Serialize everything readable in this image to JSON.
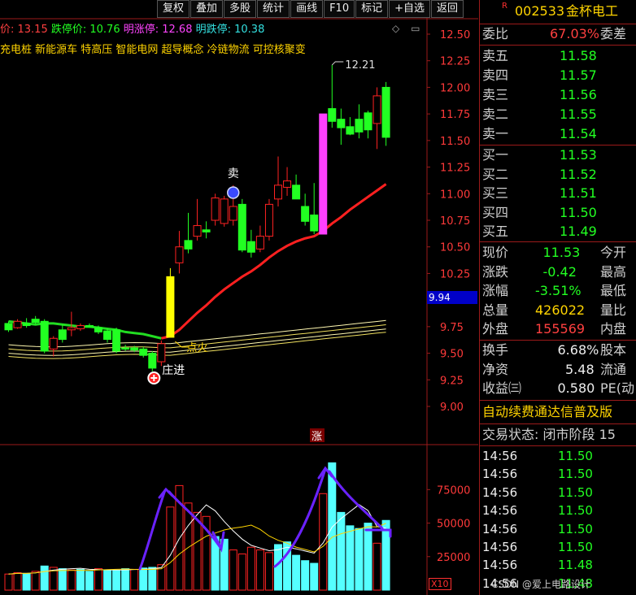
{
  "toolbar": [
    "复权",
    "叠加",
    "多股",
    "统计",
    "画线",
    "F10",
    "标记",
    "+自选",
    "返回"
  ],
  "info_line": [
    {
      "text": "价: 13.15",
      "color": "#ff4040"
    },
    {
      "text": "跌停价: 10.76",
      "color": "#22ff22"
    },
    {
      "text": "明涨停: 12.68",
      "color": "#ff44ff"
    },
    {
      "text": "明跌停: 10.38",
      "color": "#33e0e0"
    }
  ],
  "concepts": "充电桩 新能源车 特高压 智能电网 超导概念 冷链物流 可控核聚变",
  "win_icons": [
    "◇",
    "▭"
  ],
  "price_tag": "9.94",
  "volume_unit": "X10",
  "annotations": {
    "sell": "卖",
    "zhang": "涨",
    "dianguang": "点火",
    "zhuangjin": "庄进",
    "max_label": "12.21"
  },
  "colors": {
    "up": "#ff2222",
    "down": "#22ff22",
    "limit_up": "#ff40ff",
    "yellow_bar": "#ffff00",
    "ma": "#ff2020",
    "ma_green": "#22dd22",
    "cyan_vol": "#55ffff"
  },
  "chart_data": {
    "type": "candlestick",
    "price_axis": {
      "ticks": [
        "12.50",
        "12.25",
        "12.00",
        "11.75",
        "11.50",
        "11.25",
        "11.00",
        "10.75",
        "10.50",
        "10.25",
        "10.00",
        "9.75",
        "9.50",
        "9.25",
        "9.00"
      ],
      "range": [
        9.0,
        12.5
      ]
    },
    "volume_axis": {
      "ticks": [
        "75000",
        "50000",
        "25000"
      ]
    },
    "candles": [
      {
        "o": 9.78,
        "h": 9.8,
        "l": 9.7,
        "c": 9.72
      },
      {
        "o": 9.74,
        "h": 9.82,
        "l": 9.73,
        "c": 9.8
      },
      {
        "o": 9.78,
        "h": 9.83,
        "l": 9.74,
        "c": 9.76
      },
      {
        "o": 9.82,
        "h": 9.85,
        "l": 9.77,
        "c": 9.79
      },
      {
        "o": 9.8,
        "h": 9.82,
        "l": 9.5,
        "c": 9.52
      },
      {
        "o": 9.54,
        "h": 9.66,
        "l": 9.47,
        "c": 9.64
      },
      {
        "o": 9.72,
        "h": 9.77,
        "l": 9.6,
        "c": 9.63
      },
      {
        "o": 9.72,
        "h": 9.89,
        "l": 9.66,
        "c": 9.74
      },
      {
        "o": 9.73,
        "h": 9.78,
        "l": 9.71,
        "c": 9.76
      },
      {
        "o": 9.76,
        "h": 9.78,
        "l": 9.74,
        "c": 9.75
      },
      {
        "o": 9.74,
        "h": 9.76,
        "l": 9.68,
        "c": 9.7
      },
      {
        "o": 9.71,
        "h": 9.73,
        "l": 9.6,
        "c": 9.63
      },
      {
        "o": 9.72,
        "h": 9.74,
        "l": 9.5,
        "c": 9.52
      },
      {
        "o": 9.55,
        "h": 9.58,
        "l": 9.52,
        "c": 9.54
      },
      {
        "o": 9.55,
        "h": 9.57,
        "l": 9.51,
        "c": 9.53
      },
      {
        "o": 9.54,
        "h": 9.56,
        "l": 9.46,
        "c": 9.48
      },
      {
        "o": 9.5,
        "h": 9.52,
        "l": 9.33,
        "c": 9.36
      },
      {
        "o": 9.42,
        "h": 9.62,
        "l": 9.38,
        "c": 9.59
      },
      {
        "o": 9.65,
        "h": 10.3,
        "l": 9.65,
        "c": 10.22
      },
      {
        "o": 10.35,
        "h": 10.65,
        "l": 10.25,
        "c": 10.5
      },
      {
        "o": 10.56,
        "h": 10.82,
        "l": 10.44,
        "c": 10.48
      },
      {
        "o": 10.6,
        "h": 10.95,
        "l": 10.56,
        "c": 10.7
      },
      {
        "o": 10.66,
        "h": 10.74,
        "l": 10.58,
        "c": 10.64
      },
      {
        "o": 10.75,
        "h": 11.0,
        "l": 10.7,
        "c": 10.96
      },
      {
        "o": 10.72,
        "h": 10.98,
        "l": 10.69,
        "c": 10.95
      },
      {
        "o": 10.75,
        "h": 11.08,
        "l": 10.7,
        "c": 10.88
      },
      {
        "o": 10.9,
        "h": 10.95,
        "l": 10.45,
        "c": 10.47
      },
      {
        "o": 10.55,
        "h": 10.66,
        "l": 10.4,
        "c": 10.45
      },
      {
        "o": 10.48,
        "h": 10.7,
        "l": 10.45,
        "c": 10.6
      },
      {
        "o": 10.6,
        "h": 10.95,
        "l": 10.56,
        "c": 10.9
      },
      {
        "o": 10.95,
        "h": 11.35,
        "l": 10.88,
        "c": 11.08
      },
      {
        "o": 11.06,
        "h": 11.25,
        "l": 10.98,
        "c": 11.12
      },
      {
        "o": 11.08,
        "h": 11.18,
        "l": 10.96,
        "c": 10.95
      },
      {
        "o": 10.88,
        "h": 11.0,
        "l": 10.7,
        "c": 10.74
      },
      {
        "o": 10.8,
        "h": 11.1,
        "l": 10.62,
        "c": 10.65
      },
      {
        "o": 10.62,
        "h": 11.75,
        "l": 10.62,
        "c": 11.75
      },
      {
        "o": 11.8,
        "h": 12.21,
        "l": 11.62,
        "c": 11.68
      },
      {
        "o": 11.7,
        "h": 11.8,
        "l": 11.46,
        "c": 11.62
      },
      {
        "o": 11.63,
        "h": 11.72,
        "l": 11.55,
        "c": 11.56
      },
      {
        "o": 11.7,
        "h": 11.84,
        "l": 11.52,
        "c": 11.58
      },
      {
        "o": 11.76,
        "h": 11.78,
        "l": 11.52,
        "c": 11.6
      },
      {
        "o": 11.66,
        "h": 12.0,
        "l": 11.42,
        "c": 11.92
      },
      {
        "o": 12.0,
        "h": 12.05,
        "l": 11.45,
        "c": 11.53
      }
    ],
    "ma": [
      9.8,
      9.79,
      9.78,
      9.77,
      9.78,
      9.78,
      9.77,
      9.76,
      9.75,
      9.75,
      9.74,
      9.73,
      9.72,
      9.7,
      9.69,
      9.68,
      9.66,
      9.64,
      9.66,
      9.72,
      9.8,
      9.88,
      9.95,
      10.03,
      10.1,
      10.16,
      10.22,
      10.27,
      10.33,
      10.4,
      10.46,
      10.51,
      10.55,
      10.58,
      10.6,
      10.65,
      10.72,
      10.78,
      10.85,
      10.91,
      10.97,
      11.03,
      11.09
    ],
    "volumes": [
      12000,
      13000,
      12500,
      14000,
      18000,
      17000,
      16000,
      15000,
      15500,
      14000,
      16000,
      15000,
      14500,
      16000,
      15500,
      16500,
      17000,
      19000,
      62000,
      78000,
      65000,
      58000,
      55000,
      40000,
      38000,
      30000,
      27000,
      32000,
      30000,
      28000,
      34000,
      36000,
      26000,
      22000,
      20000,
      72000,
      95000,
      58000,
      48000,
      46000,
      50000,
      35000,
      52000
    ],
    "vol_colors_up": [
      true,
      true,
      false,
      true,
      false,
      true,
      false,
      true,
      false,
      false,
      true,
      false,
      false,
      false,
      true,
      false,
      false,
      true,
      true,
      true,
      true,
      true,
      true,
      false,
      false,
      true,
      true,
      true,
      true,
      true,
      false,
      false,
      false,
      false,
      false,
      true,
      false,
      false,
      false,
      false,
      false,
      true,
      false
    ]
  },
  "stock": {
    "code": "002533",
    "name": "金杯电工",
    "flag": "R"
  },
  "order_ratio": {
    "label": "委比",
    "value": "67.03%",
    "label2": "委差"
  },
  "asks": [
    {
      "label": "卖五",
      "price": "11.58"
    },
    {
      "label": "卖四",
      "price": "11.57"
    },
    {
      "label": "卖三",
      "price": "11.56"
    },
    {
      "label": "卖二",
      "price": "11.55"
    },
    {
      "label": "卖一",
      "price": "11.54"
    }
  ],
  "bids": [
    {
      "label": "买一",
      "price": "11.53"
    },
    {
      "label": "买二",
      "price": "11.52"
    },
    {
      "label": "买三",
      "price": "11.51"
    },
    {
      "label": "买四",
      "price": "11.50"
    },
    {
      "label": "买五",
      "price": "11.49"
    }
  ],
  "quote": [
    {
      "label": "现价",
      "value": "11.53",
      "color": "green",
      "label2": "今开"
    },
    {
      "label": "涨跌",
      "value": "-0.42",
      "color": "green",
      "label2": "最高"
    },
    {
      "label": "涨幅",
      "value": "-3.51%",
      "color": "green",
      "label2": "最低"
    },
    {
      "label": "总量",
      "value": "426022",
      "color": "yellow",
      "label2": "量比"
    },
    {
      "label": "外盘",
      "value": "155569",
      "color": "red",
      "label2": "内盘"
    }
  ],
  "fundamentals": [
    {
      "label": "换手",
      "value": "6.68%",
      "label2": "股本"
    },
    {
      "label": "净资",
      "value": "5.48",
      "label2": "流通"
    },
    {
      "label": "收益㈢",
      "value": "0.580",
      "label2": "PE(动"
    }
  ],
  "promo": "自动续费通达信普及版",
  "trade_status": "交易状态: 闭市阶段 15",
  "ticks": [
    {
      "time": "14:56",
      "price": "11.50"
    },
    {
      "time": "14:56",
      "price": "11.50"
    },
    {
      "time": "14:56",
      "price": "11.50"
    },
    {
      "time": "14:56",
      "price": "11.50"
    },
    {
      "time": "14:56",
      "price": "11.50"
    },
    {
      "time": "14:56",
      "price": "11.50"
    },
    {
      "time": "14:56",
      "price": "11.48"
    },
    {
      "time": "14:56",
      "price": "11.48"
    }
  ],
  "watermark": "CSDN @爱上电路设计"
}
